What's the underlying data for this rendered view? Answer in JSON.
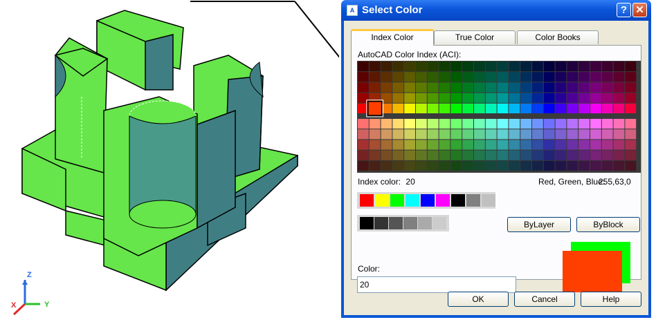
{
  "dialog": {
    "title": "Select Color",
    "title_icon": "autocad-color-icon",
    "help_glyph": "?",
    "close_glyph": "✕",
    "tabs": [
      {
        "label": "Index Color",
        "active": true
      },
      {
        "label": "True Color",
        "active": false
      },
      {
        "label": "Color Books",
        "active": false
      }
    ],
    "aci_label": "AutoCAD Color Index (ACI):",
    "index_color_label": "Index color:",
    "index_color_value": "20",
    "rgb_label": "Red, Green, Blue:",
    "rgb_value": "255,63,0",
    "standard_colors": [
      "#ff0000",
      "#ffff00",
      "#00ff00",
      "#00ffff",
      "#0000ff",
      "#ff00ff",
      "#000000",
      "#808080",
      "#c0c0c0"
    ],
    "gray_colors": [
      "#000000",
      "#333333",
      "#555555",
      "#808080",
      "#aaaaaa",
      "#cccccc"
    ],
    "bylayer_label": "ByLayer",
    "byblock_label": "ByBlock",
    "color_label": "Color:",
    "color_value": "20",
    "selected_color": "#ff3f00",
    "previous_color": "#00ff00",
    "ok_label": "OK",
    "cancel_label": "Cancel",
    "help_label": "Help"
  },
  "viewport": {
    "axis_labels": {
      "z": "Z",
      "y": "Y",
      "x": "X"
    },
    "model_color": "#66e64a",
    "shade_color": "#3f7f84"
  }
}
